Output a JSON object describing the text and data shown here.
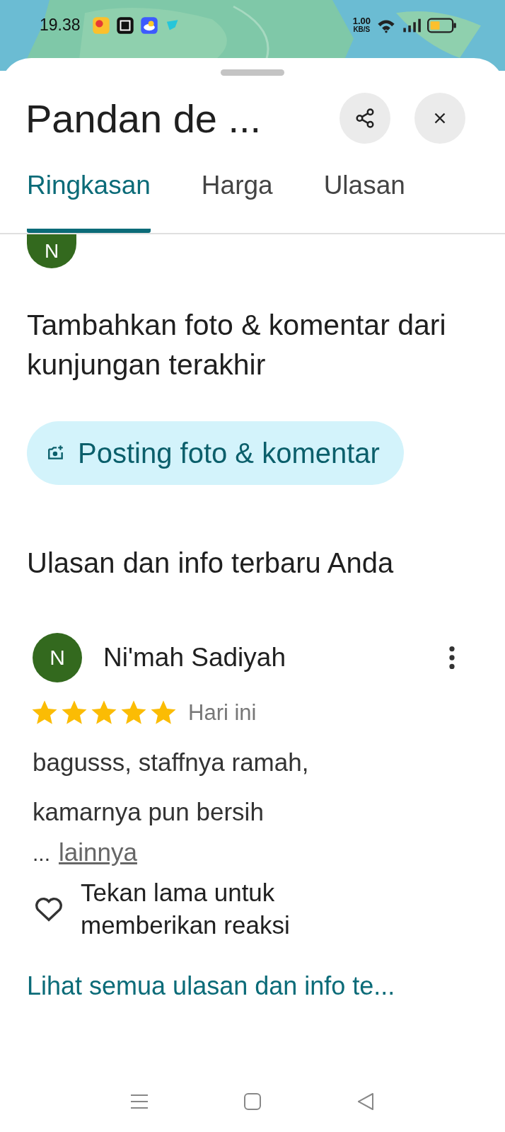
{
  "status_bar": {
    "time": "19.38",
    "speed_value": "1.00",
    "speed_unit": "KB/S"
  },
  "header": {
    "title": "Pandan de ..."
  },
  "tabs": [
    {
      "label": "Ringkasan",
      "selected": true
    },
    {
      "label": "Harga",
      "selected": false
    },
    {
      "label": "Ulasan",
      "selected": false
    }
  ],
  "cut_avatar": {
    "initial": "N"
  },
  "prompt": {
    "heading": "Tambahkan foto & komentar dari kunjungan terakhir",
    "button": "Posting foto & komentar"
  },
  "your_reviews": {
    "heading": "Ulasan dan info terbaru Anda",
    "review": {
      "initial": "N",
      "name": "Ni'mah Sadiyah",
      "stars": 5,
      "date": "Hari ini",
      "text": "bagusss, staffnya ramah,\nkamarnya pun bersih",
      "ellipsis": "...",
      "more": "lainnya",
      "reaction_hint": "Tekan lama untuk memberikan reaksi"
    },
    "see_all": "Lihat semua ulasan dan info te..."
  }
}
